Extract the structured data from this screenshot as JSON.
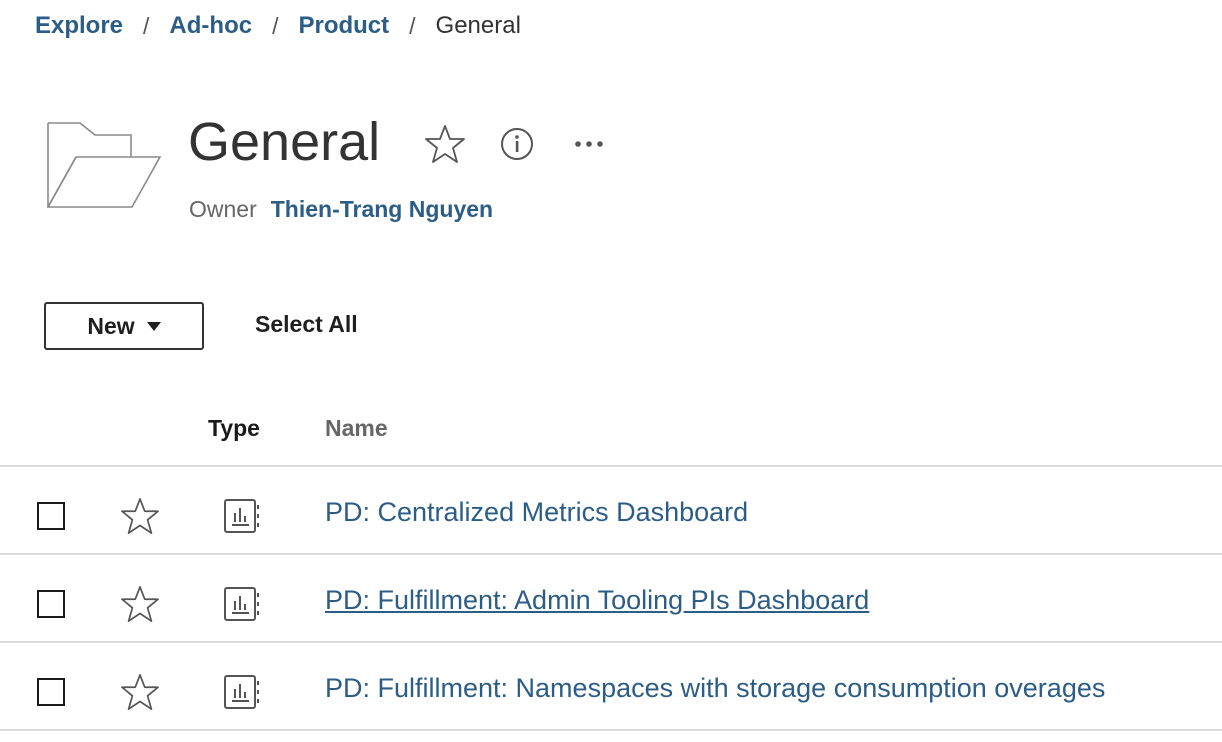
{
  "breadcrumb": {
    "items": [
      "Explore",
      "Ad-hoc",
      "Product"
    ],
    "separator": "/",
    "current": "General"
  },
  "header": {
    "title": "General",
    "owner_label": "Owner",
    "owner_name": "Thien-Trang Nguyen",
    "icons": [
      "folder-icon",
      "star-icon",
      "info-icon",
      "more-icon"
    ]
  },
  "toolbar": {
    "new_label": "New",
    "select_all_label": "Select All"
  },
  "table": {
    "columns": [
      "Type",
      "Name"
    ],
    "rows": [
      {
        "name": "PD: Centralized Metrics Dashboard",
        "type_icon": "workbook-icon",
        "hovered": false
      },
      {
        "name": "PD: Fulfillment: Admin Tooling PIs Dashboard",
        "type_icon": "workbook-icon",
        "hovered": true
      },
      {
        "name": "PD: Fulfillment: Namespaces with storage consumption overages",
        "type_icon": "workbook-icon",
        "hovered": false
      }
    ]
  },
  "colors": {
    "link": "#2c5d87",
    "text": "#333333",
    "divider": "#dcdcdc"
  }
}
